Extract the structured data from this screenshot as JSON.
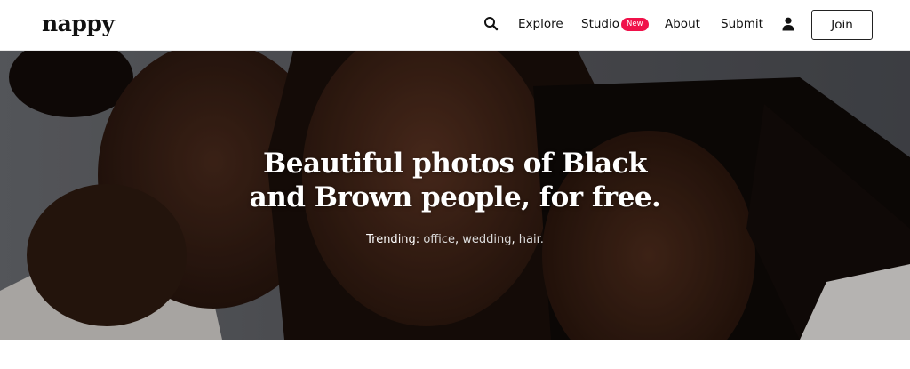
{
  "header": {
    "logo": "nappy",
    "nav": {
      "explore": "Explore",
      "studio": "Studio",
      "studio_badge": "New",
      "about": "About",
      "submit": "Submit",
      "join": "Join"
    },
    "icons": {
      "search": "search-icon",
      "user": "user-icon"
    },
    "colors": {
      "badge": "#f0114a"
    }
  },
  "hero": {
    "title_line1": "Beautiful photos of Black",
    "title_line2": "and Brown people, for free.",
    "trending_label": "Trending:",
    "trending_items": [
      "office",
      "wedding",
      "hair."
    ]
  }
}
